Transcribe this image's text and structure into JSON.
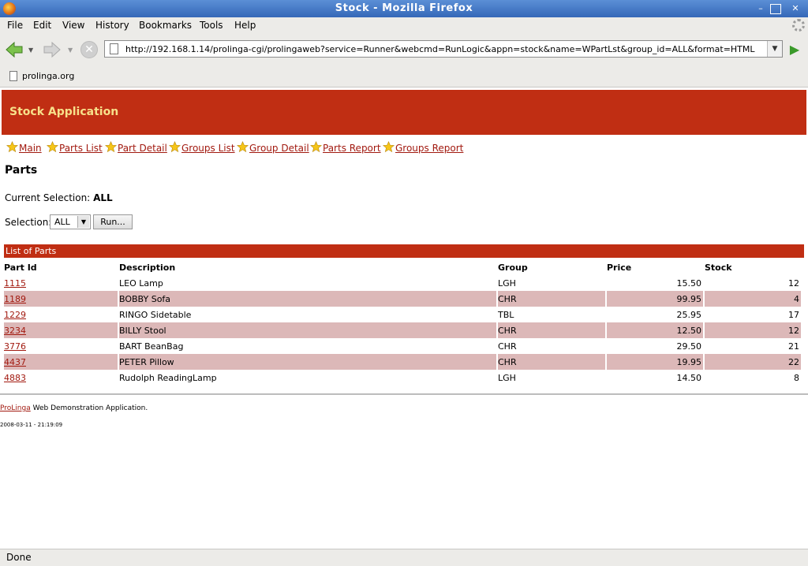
{
  "window": {
    "title": "Stock - Mozilla Firefox",
    "minimize": "–",
    "maximize": "□",
    "close": "✕"
  },
  "menu": [
    "File",
    "Edit",
    "View",
    "History",
    "Bookmarks",
    "Tools",
    "Help"
  ],
  "nav": {
    "url": "http://192.168.1.14/prolinga-cgi/prolingaweb?service=Runner&webcmd=RunLogic&appn=stock&name=WPartLst&group_id=ALL&format=HTML"
  },
  "bookmarks": [
    "prolinga.org"
  ],
  "app": {
    "header": "Stock Application",
    "links": [
      "Main",
      "Parts List",
      "Part Detail",
      "Groups List",
      "Group Detail",
      "Parts Report",
      "Groups Report"
    ],
    "page_title": "Parts",
    "current_selection_label": "Current Selection:",
    "current_selection_value": "ALL",
    "selection_label": "Selection:",
    "selection_value": "ALL",
    "run_label": "Run...",
    "list_title": "List of Parts",
    "columns": [
      "Part Id",
      "Description",
      "Group",
      "Price",
      "Stock"
    ],
    "rows": [
      [
        "1115",
        "LEO Lamp",
        "LGH",
        "15.50",
        "12"
      ],
      [
        "1189",
        "BOBBY Sofa",
        "CHR",
        "99.95",
        "4"
      ],
      [
        "1229",
        "RINGO Sidetable",
        "TBL",
        "25.95",
        "17"
      ],
      [
        "3234",
        "BILLY Stool",
        "CHR",
        "12.50",
        "12"
      ],
      [
        "3776",
        "BART BeanBag",
        "CHR",
        "29.50",
        "21"
      ],
      [
        "4437",
        "PETER Pillow",
        "CHR",
        "19.95",
        "22"
      ],
      [
        "4883",
        "Rudolph ReadingLamp",
        "LGH",
        "14.50",
        "8"
      ]
    ],
    "footer_link": "ProLinga",
    "footer_text": " Web Demonstration Application.",
    "timestamp": "2008-03-11 - 21:19:09"
  },
  "status": "Done",
  "colors": {
    "brand": "#c02e13",
    "header_text": "#f7e08a",
    "link": "#a21a10",
    "row_alt": "#dcb8b8"
  }
}
